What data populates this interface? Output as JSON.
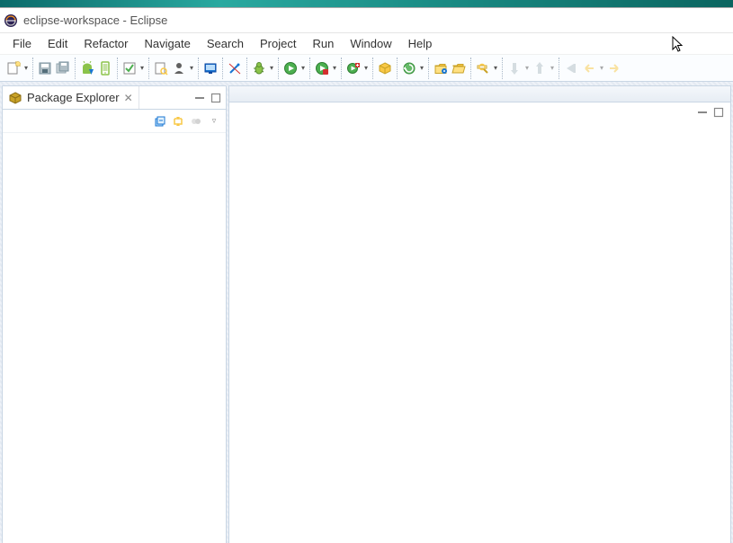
{
  "title": "eclipse-workspace - Eclipse",
  "menu": {
    "file": "File",
    "edit": "Edit",
    "refactor": "Refactor",
    "navigate": "Navigate",
    "search": "Search",
    "project": "Project",
    "run": "Run",
    "window": "Window",
    "help": "Help"
  },
  "views": {
    "package_explorer": {
      "label": "Package Explorer",
      "close_glyph": "✕"
    }
  },
  "glyphs": {
    "dropdown": "▾",
    "minimize": "▬",
    "maximize": "▢",
    "view_menu": "▿"
  },
  "colors": {
    "run_green": "#4caf50",
    "debug_green": "#2e7d32",
    "accent_blue": "#1976d2",
    "folder_yellow": "#f9c846",
    "red": "#d32f2f"
  },
  "toolbar": {
    "groups": [
      {
        "id": "new",
        "icons": [
          "new"
        ],
        "dropdown": true
      },
      {
        "id": "save",
        "icons": [
          "save",
          "save-all"
        ]
      },
      {
        "id": "android",
        "icons": [
          "android-sdk",
          "android-avd"
        ]
      },
      {
        "id": "checkbox",
        "icons": [
          "checkbox"
        ],
        "dropdown": true
      },
      {
        "id": "open-type",
        "icons": [
          "open-type",
          "person"
        ],
        "dropdown": true
      },
      {
        "id": "screen",
        "icons": [
          "screen"
        ]
      },
      {
        "id": "wand",
        "icons": [
          "wand"
        ]
      },
      {
        "id": "debug",
        "icons": [
          "debug"
        ],
        "dropdown": true
      },
      {
        "id": "run",
        "icons": [
          "run"
        ],
        "dropdown": true
      },
      {
        "id": "run-last",
        "icons": [
          "run-last"
        ],
        "dropdown": true
      },
      {
        "id": "external",
        "icons": [
          "external"
        ],
        "dropdown": true
      },
      {
        "id": "new-pkg",
        "icons": [
          "new-pkg"
        ]
      },
      {
        "id": "build",
        "icons": [
          "build"
        ],
        "dropdown": true
      },
      {
        "id": "open-folder",
        "icons": [
          "open-task",
          "open-folder"
        ]
      },
      {
        "id": "search-tb",
        "icons": [
          "search"
        ],
        "dropdown": true
      },
      {
        "id": "nav",
        "icons": [
          "prev-ann",
          "next-ann"
        ],
        "dropdown": true
      },
      {
        "id": "history",
        "icons": [
          "last-edit",
          "back",
          "forward"
        ]
      }
    ]
  }
}
